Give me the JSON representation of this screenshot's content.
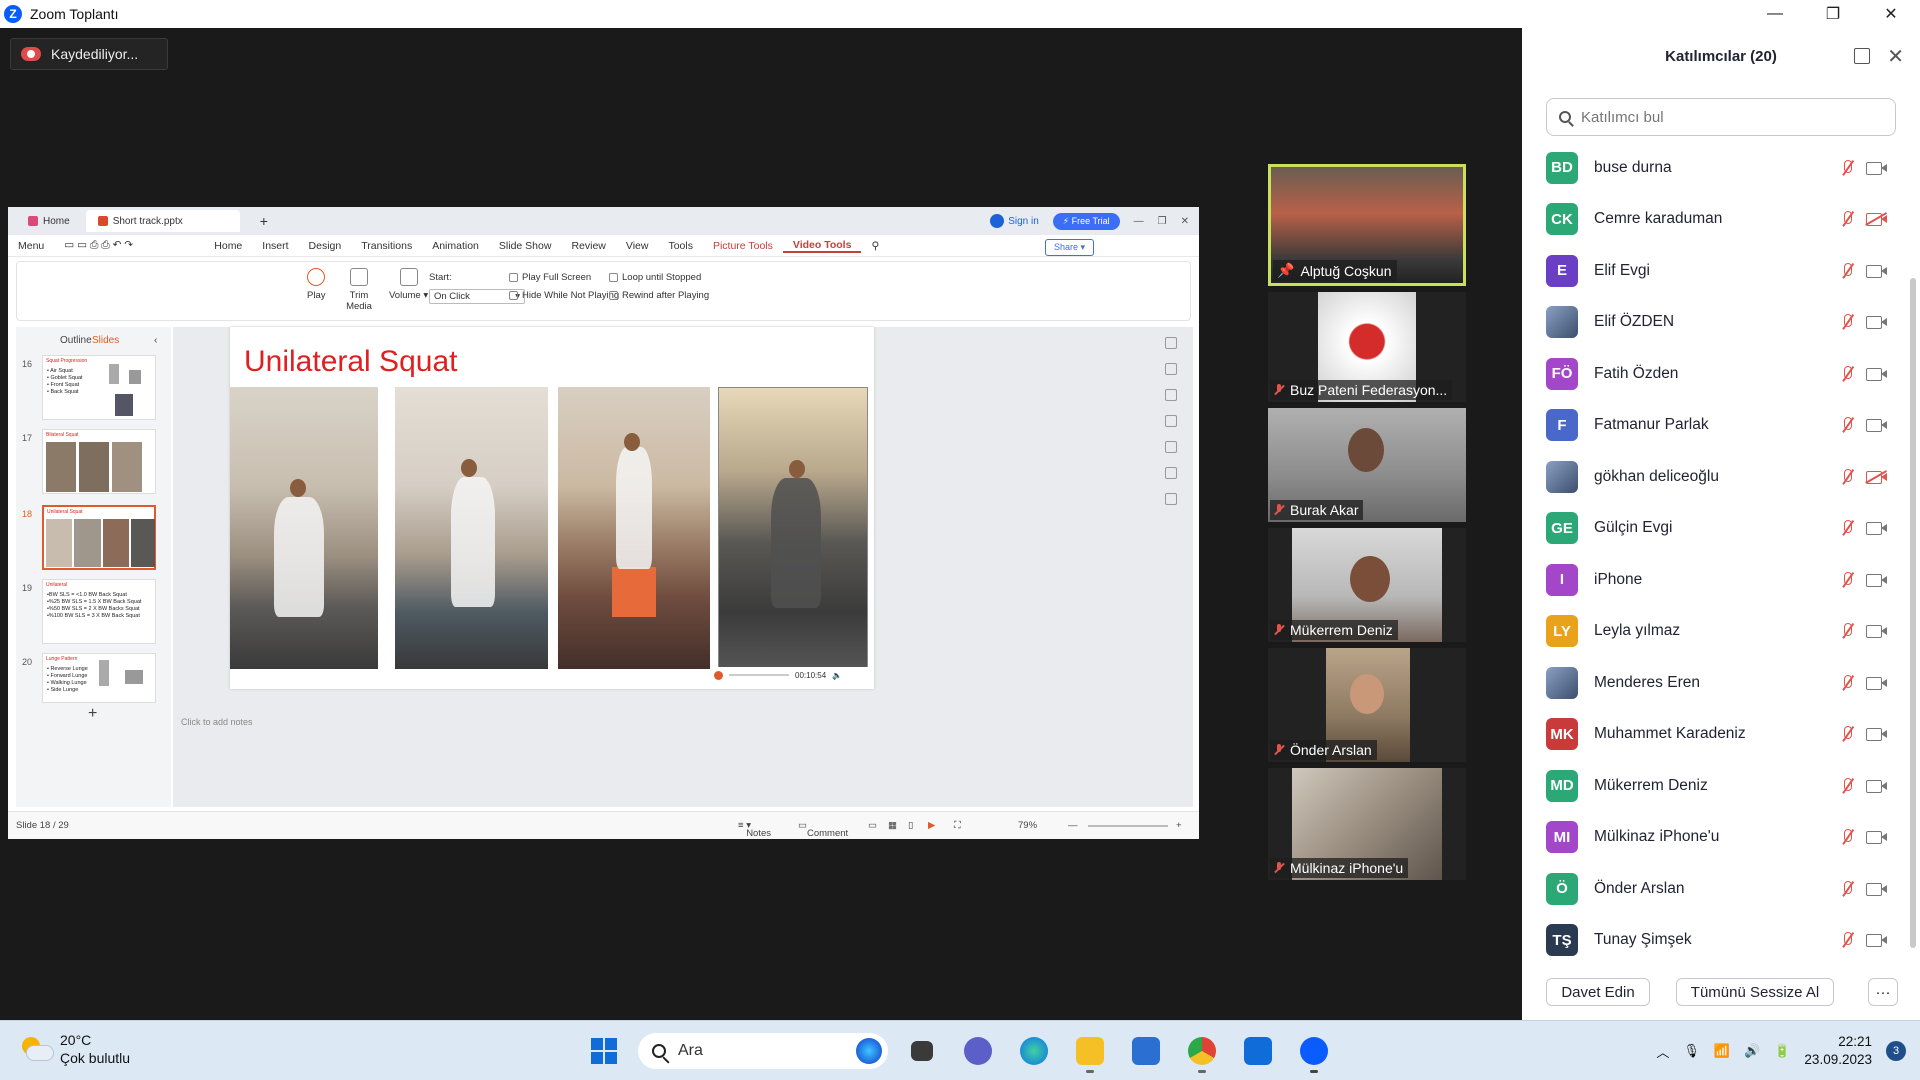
{
  "window": {
    "title": "Zoom Toplantı",
    "recording_label": "Kaydediliyor..."
  },
  "presentation": {
    "tabs": [
      {
        "label": "Home"
      },
      {
        "label": "Short track.pptx"
      }
    ],
    "sign_in": "Sign in",
    "free_trial": "Free Trial",
    "menu": [
      "Menu",
      "Home",
      "Insert",
      "Design",
      "Transitions",
      "Animation",
      "Slide Show",
      "Review",
      "View",
      "Tools",
      "Picture Tools",
      "Video Tools"
    ],
    "share": "Share",
    "ribbon": {
      "play": "Play",
      "trim_media": "Trim Media",
      "volume": "Volume",
      "start_label": "Start:",
      "start_value": "On Click",
      "play_full_screen": "Play Full Screen",
      "hide_while_not_playing": "Hide While Not Playing",
      "loop_until_stopped": "Loop until Stopped",
      "rewind_after_playing": "Rewind after Playing"
    },
    "side_tabs": {
      "outline": "Outline",
      "slides": "Slides"
    },
    "thumbnails": [
      {
        "num": "16",
        "title": "Squat Progression",
        "lines": "• Air Squat\n• Goblet Squat\n• Front Squat\n• Back Squat"
      },
      {
        "num": "17",
        "title": "Bilateral Squat",
        "lines": ""
      },
      {
        "num": "18",
        "title": "Unilateral Squat",
        "lines": ""
      },
      {
        "num": "19",
        "title": "Unilateral",
        "lines": "•BW SLS = <1.0 BW Back Squat\n•%25 BW SLS = 1.5 X BW Back Squat\n•%50 BW SLS = 2 X BW Backs Squat\n•%100 BW SLS = 3 X BW Back Squat"
      },
      {
        "num": "20",
        "title": "Lunge Pattern",
        "lines": "• Reverse Lunge\n• Forward Lunge\n• Walking Lunge\n• Side Lunge"
      }
    ],
    "slide_title": "Unilateral Squat",
    "media_time": "00:10:54",
    "notes_placeholder": "Click to add notes",
    "status": {
      "slide_counter": "Slide 18 / 29",
      "notes": "Notes",
      "comment": "Comment",
      "zoom": "79%"
    }
  },
  "video_tiles": [
    {
      "name": "Alptuğ Coşkun",
      "active": true
    },
    {
      "name": "Buz Pateni Federasyon..."
    },
    {
      "name": "Burak Akar"
    },
    {
      "name": "Mükerrem Deniz"
    },
    {
      "name": "Önder Arslan"
    },
    {
      "name": "Mülkinaz iPhone'u"
    }
  ],
  "participants_panel": {
    "title": "Katılımcılar (20)",
    "search_placeholder": "Katılımcı bul",
    "participants": [
      {
        "initials": "BD",
        "name": "buse durna",
        "color": "#2ba876",
        "cam_off": false
      },
      {
        "initials": "CK",
        "name": "Cemre karaduman",
        "color": "#2ba876",
        "cam_off": true
      },
      {
        "initials": "E",
        "name": "Elif Evgi",
        "color": "#6b3fc4",
        "cam_off": false
      },
      {
        "initials": "",
        "name": "Elif ÖZDEN",
        "color": "#3c4e6c",
        "cam_off": false,
        "photo": true
      },
      {
        "initials": "FÖ",
        "name": "Fatih Özden",
        "color": "#a346c9",
        "cam_off": false
      },
      {
        "initials": "F",
        "name": "Fatmanur Parlak",
        "color": "#4a68c9",
        "cam_off": false
      },
      {
        "initials": "",
        "name": "gökhan deliceoğlu",
        "color": "#3c4e6c",
        "cam_off": true,
        "photo": true
      },
      {
        "initials": "GE",
        "name": "Gülçin Evgi",
        "color": "#2ba876",
        "cam_off": false
      },
      {
        "initials": "I",
        "name": "iPhone",
        "color": "#a346c9",
        "cam_off": false
      },
      {
        "initials": "LY",
        "name": "Leyla yılmaz",
        "color": "#e8a21c",
        "cam_off": false
      },
      {
        "initials": "",
        "name": "Menderes Eren",
        "color": "#3c4e6c",
        "cam_off": false,
        "photo": true
      },
      {
        "initials": "MK",
        "name": "Muhammet Karadeniz",
        "color": "#c93a3a",
        "cam_off": false
      },
      {
        "initials": "MD",
        "name": "Mükerrem Deniz",
        "color": "#2ba876",
        "cam_off": false
      },
      {
        "initials": "MI",
        "name": "Mülkinaz iPhone'u",
        "color": "#a346c9",
        "cam_off": false
      },
      {
        "initials": "Ö",
        "name": "Önder Arslan",
        "color": "#2ba876",
        "cam_off": false
      },
      {
        "initials": "TŞ",
        "name": "Tunay Şimşek",
        "color": "#2a3a50",
        "cam_off": false
      }
    ],
    "invite": "Davet Edin",
    "mute_all": "Tümünü Sessize Al",
    "more": "···"
  },
  "taskbar": {
    "temperature": "20°C",
    "weather": "Çok bulutlu",
    "search": "Ara",
    "time": "22:21",
    "date": "23.09.2023",
    "notifications": "3"
  }
}
